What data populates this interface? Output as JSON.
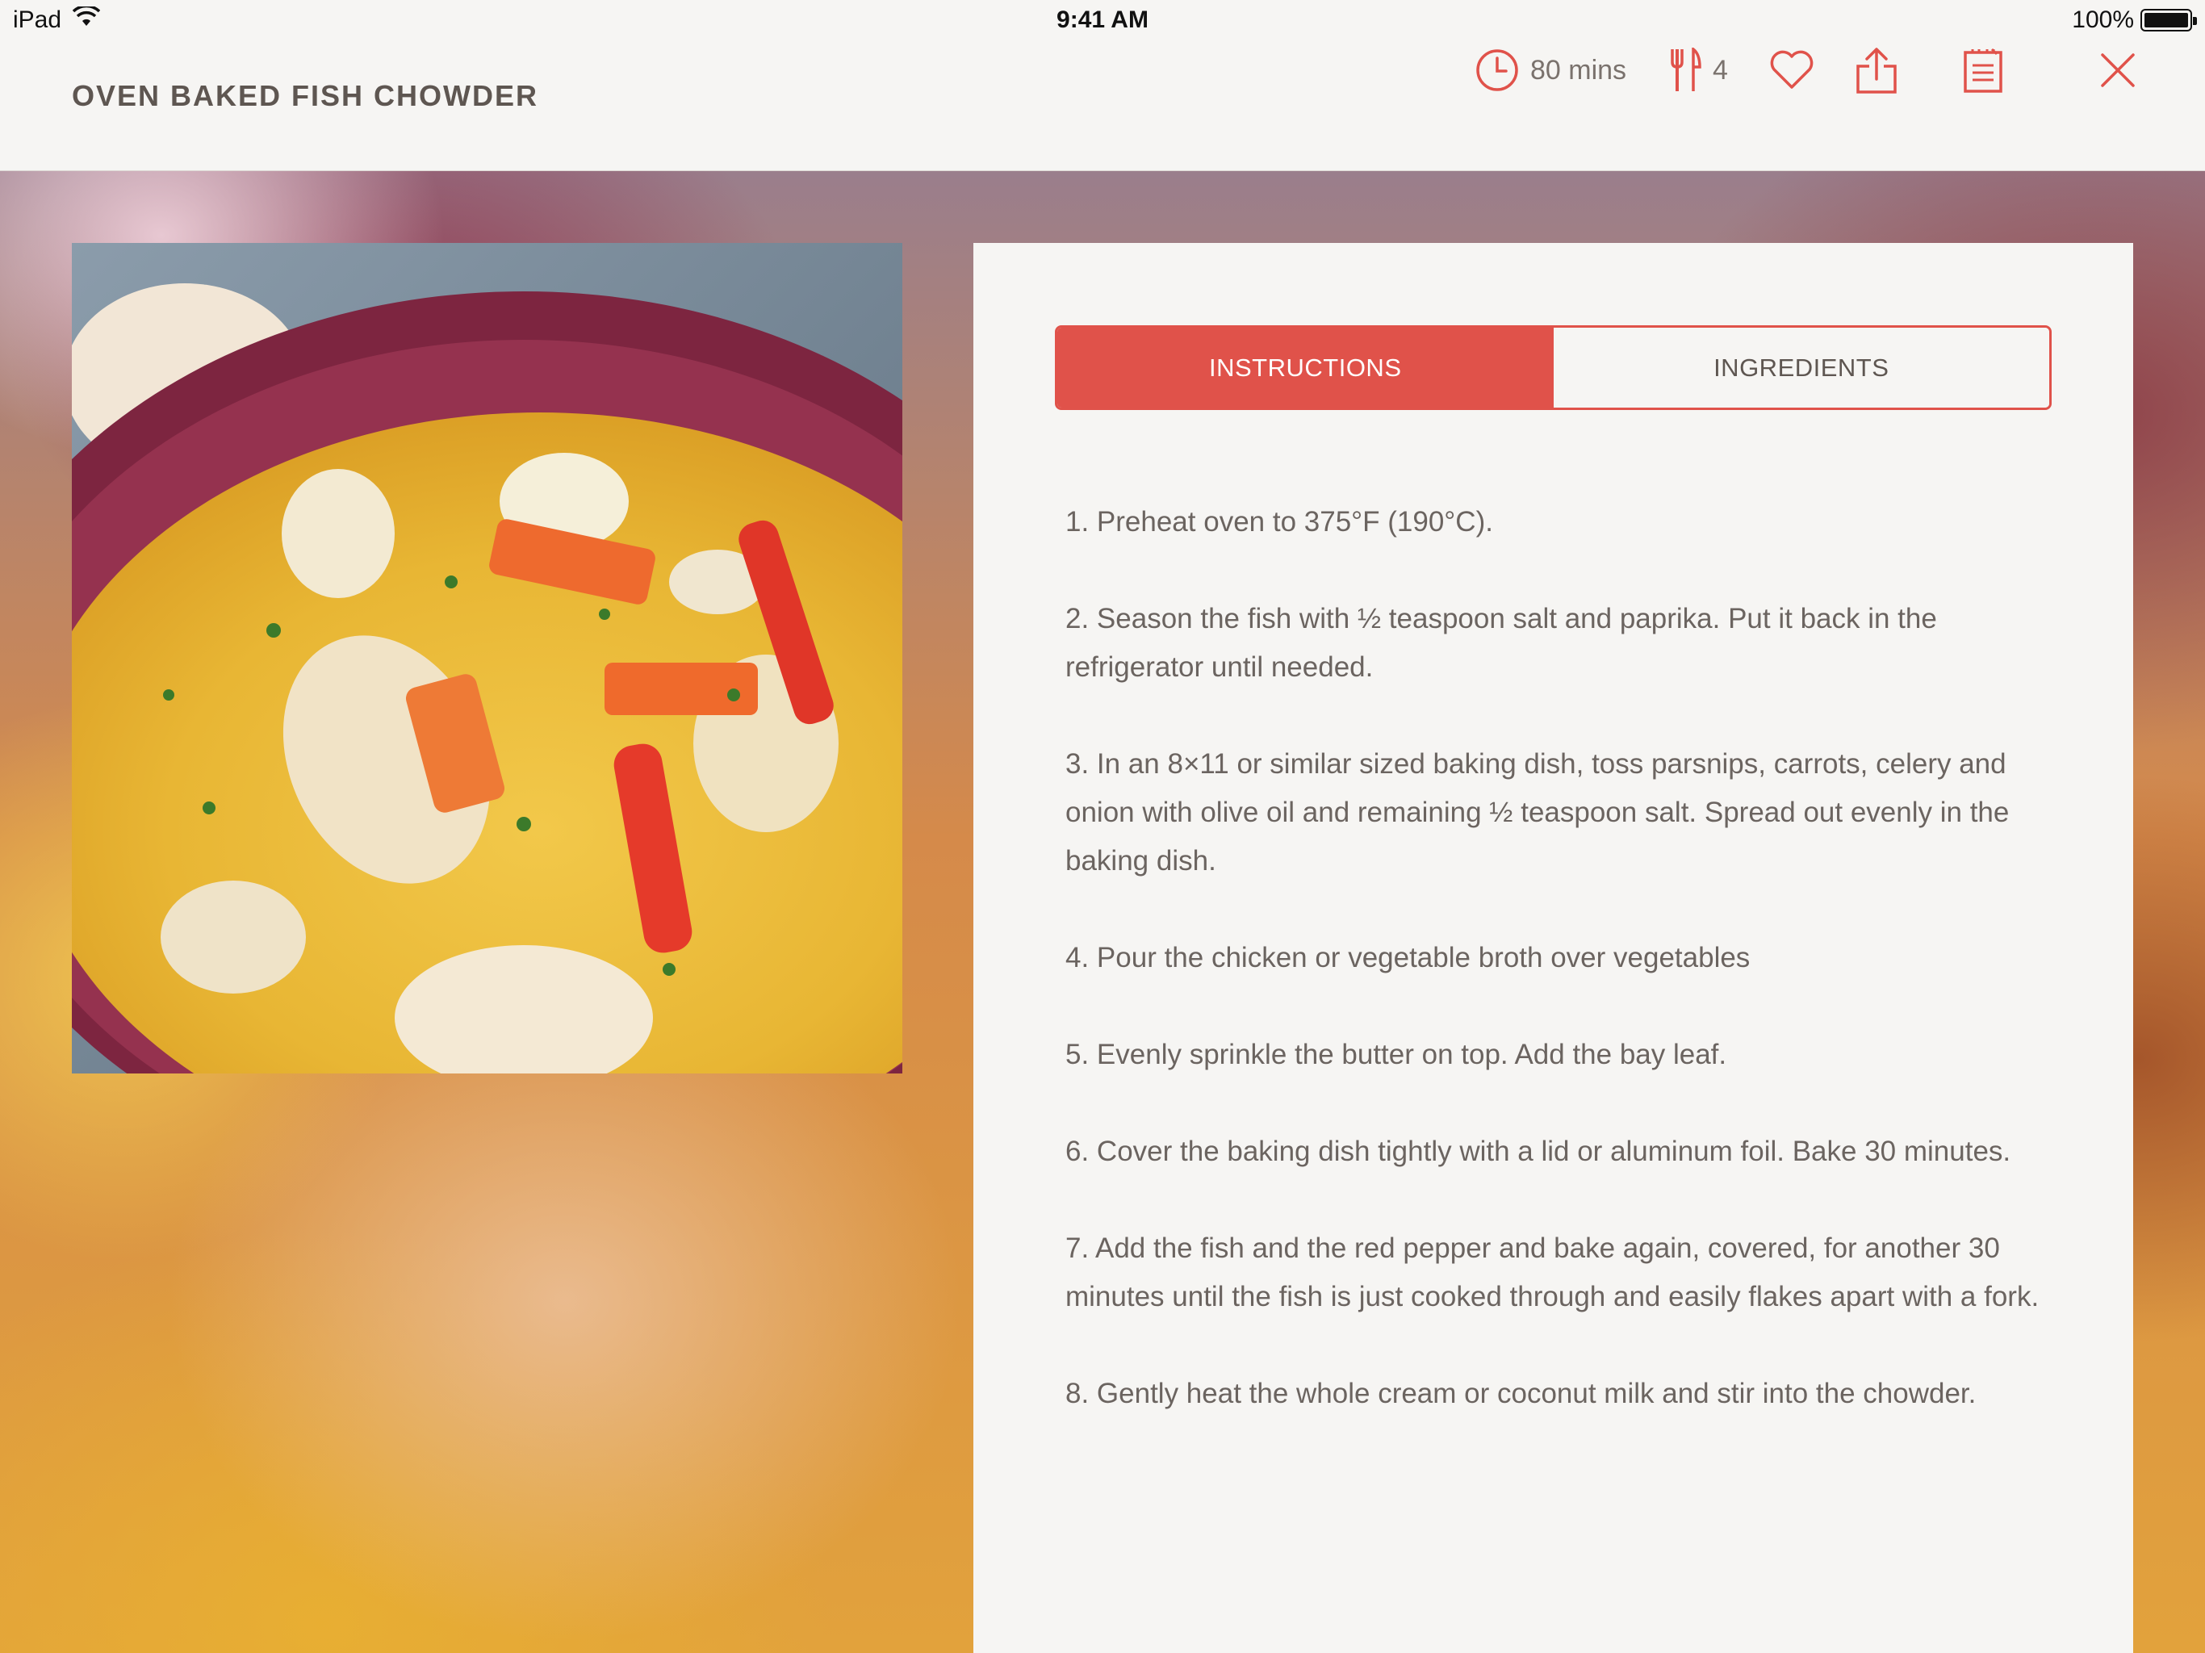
{
  "status_bar": {
    "device": "iPad",
    "time": "9:41 AM",
    "battery": "100%"
  },
  "header": {
    "title": "OVEN BAKED FISH CHOWDER",
    "time_label": "80 mins",
    "servings_label": "4",
    "icons": [
      "clock-icon",
      "fork-knife-icon",
      "heart-icon",
      "share-icon",
      "shopping-list-icon",
      "close-icon"
    ]
  },
  "colors": {
    "accent": "#e0524a",
    "text": "#6b6460",
    "background": "#f6f5f3"
  },
  "tabs": [
    {
      "label": "INSTRUCTIONS",
      "active": true
    },
    {
      "label": "INGREDIENTS",
      "active": false
    }
  ],
  "steps": [
    "1. Preheat oven to 375°F (190°C).",
    "2. Season the fish with ½ teaspoon salt and paprika. Put it back in the refrigerator until needed.",
    "3. In an 8×11 or similar sized baking dish, toss parsnips, carrots, celery and onion with olive oil and remaining ½ teaspoon salt. Spread out evenly in the baking dish.",
    "4. Pour the chicken or vegetable broth over vegetables",
    "5. Evenly sprinkle the butter on top. Add the bay leaf.",
    "6. Cover the baking dish tightly with a lid or aluminum foil. Bake 30 minutes.",
    "7. Add the fish and the red pepper and bake again, covered, for another 30 minutes until the fish is just cooked through and easily flakes apart with a fork.",
    "8. Gently heat the whole cream or coconut milk and stir into the chowder."
  ]
}
